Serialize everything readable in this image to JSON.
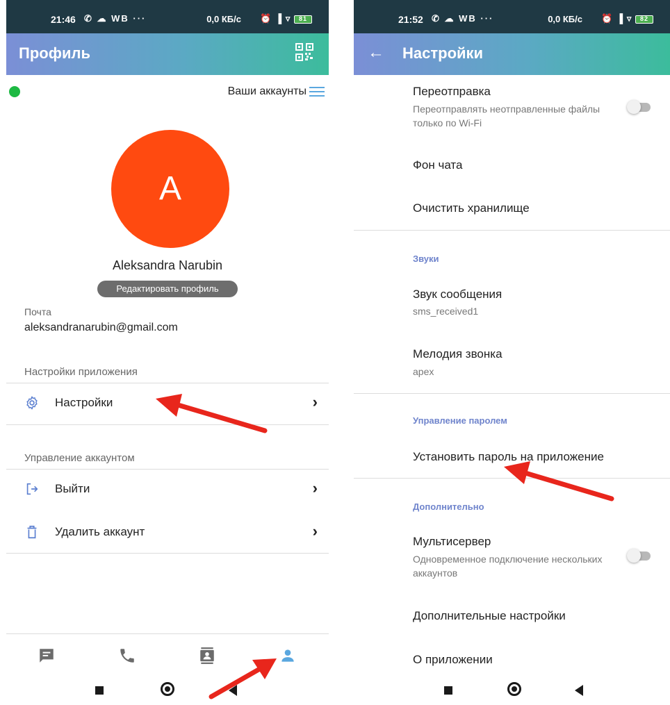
{
  "left": {
    "status": {
      "time": "21:46",
      "icons_left": "✆ ☁ WB ···",
      "speed": "0,0 КБ/c",
      "icons_right": "⏰ ▐ ▿",
      "battery": "81"
    },
    "appbar": {
      "title": "Профиль"
    },
    "accounts_label": "Ваши аккаунты",
    "avatar_letter": "A",
    "name": "Aleksandra Narubin",
    "edit_profile": "Редактировать профиль",
    "mail_label": "Почта",
    "mail_value": "aleksandranarubin@gmail.com",
    "app_settings_header": "Настройки приложения",
    "settings_item": "Настройки",
    "account_header": "Управление аккаунтом",
    "logout_item": "Выйти",
    "delete_item": "Удалить аккаунт",
    "chevron": "›"
  },
  "right": {
    "status": {
      "time": "21:52",
      "icons_left": "✆ ☁ WB ···",
      "speed": "0,0 КБ/c",
      "icons_right": "⏰ ▐ ▿",
      "battery": "82"
    },
    "appbar": {
      "title": "Настройки",
      "back": "←"
    },
    "resend": {
      "title": "Переотправка",
      "sub": "Переотправлять неотправленные файлы только по Wi-Fi",
      "enabled": false
    },
    "chat_bg": "Фон чата",
    "clear_storage": "Очистить хранилище",
    "sounds_header": "Звуки",
    "msg_sound": {
      "title": "Звук сообщения",
      "value": "sms_received1"
    },
    "ringtone": {
      "title": "Мелодия звонка",
      "value": "apex"
    },
    "password_header": "Управление паролем",
    "set_password": "Установить пароль на приложение",
    "extra_header": "Дополнительно",
    "multiserver": {
      "title": "Мультисервер",
      "sub": "Одновременное подключение нескольких аккаунтов",
      "enabled": false
    },
    "extra_settings": "Дополнительные настройки",
    "about": "О приложении"
  },
  "colors": {
    "appbar_start": "#7b8fd6",
    "appbar_end": "#3cbc9c",
    "avatar": "#ff4a10",
    "online": "#1db943",
    "accent": "#5aa7df",
    "section_header": "#6f84cc",
    "annotation_arrow": "#e8261c"
  }
}
